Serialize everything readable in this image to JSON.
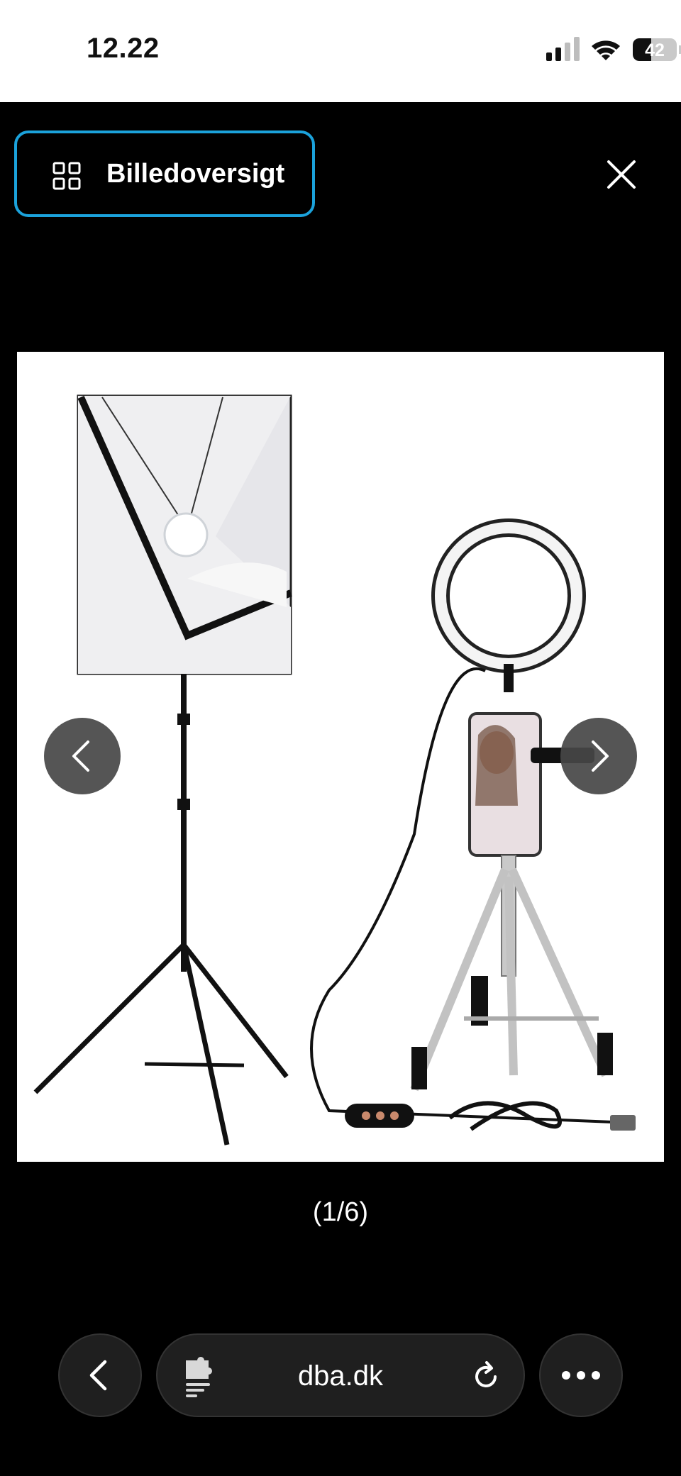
{
  "status_bar": {
    "time": "12.22",
    "battery_percent": "42",
    "battery_level": 0.42,
    "icons": [
      "signal-icon",
      "wifi-icon",
      "battery-icon"
    ]
  },
  "gallery": {
    "overview_label": "Billedoversigt",
    "counter": "(1/6)",
    "accent_color": "#1ba2db"
  },
  "browser": {
    "site": "dba.dk"
  }
}
